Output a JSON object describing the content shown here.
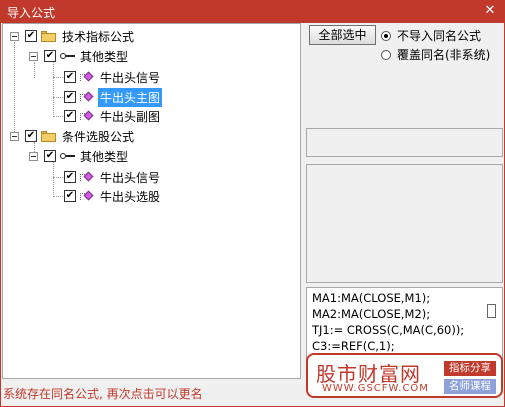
{
  "window": {
    "title": "导入公式",
    "close_glyph": "✕"
  },
  "tree": {
    "group1": {
      "label": "技术指标公式",
      "sub": {
        "label": "其他类型",
        "items": [
          {
            "label": "牛出头信号"
          },
          {
            "label": "牛出头主图"
          },
          {
            "label": "牛出头副图"
          }
        ]
      }
    },
    "group2": {
      "label": "条件选股公式",
      "sub": {
        "label": "其他类型",
        "items": [
          {
            "label": "牛出头信号"
          },
          {
            "label": "牛出头选股"
          }
        ]
      }
    },
    "check_glyph": "✔",
    "selected_item": "牛出头主图"
  },
  "buttons": {
    "select_all": "全部选中"
  },
  "options": {
    "no_import": "不导入同名公式",
    "overwrite": "覆盖同名(非系统)",
    "selected": "no_import"
  },
  "code": {
    "lines": [
      "MA1:MA(CLOSE,M1);",
      "MA2:MA(CLOSE,M2);",
      "TJ1:= CROSS(C,MA(C,60));",
      "C3:=REF(C,1);"
    ]
  },
  "status": "系统存在同名公式, 再次点击可以更名",
  "watermark": {
    "name": "股市财富网",
    "url": "WWW.GSCFW.COM",
    "tag1": "指标分享",
    "tag2": "名师课程"
  },
  "colors": {
    "titlebar": "#c0392b",
    "selection": "#3399ff",
    "status": "#c0392b",
    "tag2": "#8da2d9"
  }
}
